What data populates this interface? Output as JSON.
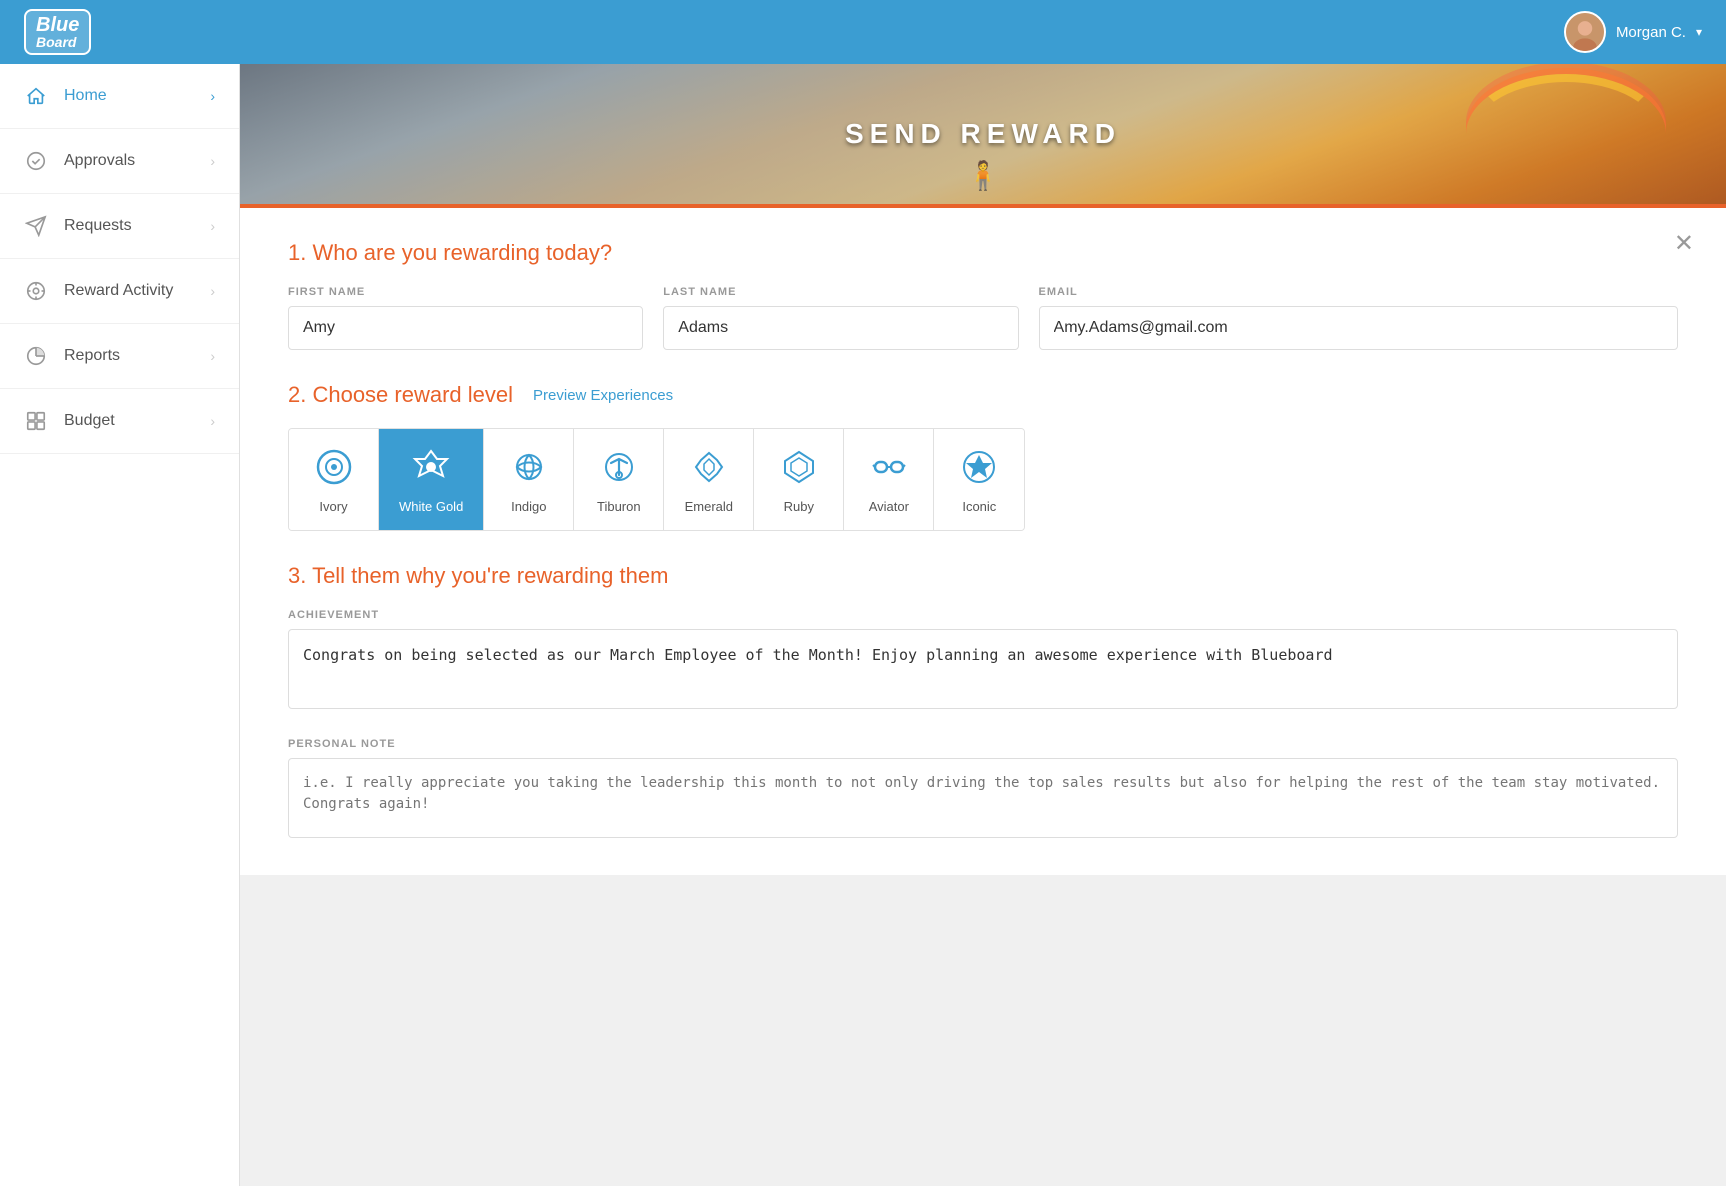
{
  "header": {
    "logo": "BlueBoard",
    "user_name": "Morgan C.",
    "chevron": "▾"
  },
  "sidebar": {
    "items": [
      {
        "id": "home",
        "label": "Home",
        "active": true
      },
      {
        "id": "approvals",
        "label": "Approvals",
        "active": false
      },
      {
        "id": "requests",
        "label": "Requests",
        "active": false
      },
      {
        "id": "reward-activity",
        "label": "Reward Activity",
        "active": false
      },
      {
        "id": "reports",
        "label": "Reports",
        "active": false
      },
      {
        "id": "budget",
        "label": "Budget",
        "active": false
      }
    ]
  },
  "hero": {
    "title": "SEND REWARD"
  },
  "form": {
    "section1_title": "1. Who are you rewarding today?",
    "first_name_label": "FIRST NAME",
    "first_name_value": "Amy",
    "last_name_label": "LAST NAME",
    "last_name_value": "Adams",
    "email_label": "EMAIL",
    "email_value": "Amy.Adams@gmail.com",
    "section2_title": "2. Choose reward level",
    "preview_link": "Preview Experiences",
    "reward_levels": [
      {
        "id": "ivory",
        "name": "Ivory",
        "active": false
      },
      {
        "id": "white-gold",
        "name": "White Gold",
        "active": true
      },
      {
        "id": "indigo",
        "name": "Indigo",
        "active": false
      },
      {
        "id": "tiburon",
        "name": "Tiburon",
        "active": false
      },
      {
        "id": "emerald",
        "name": "Emerald",
        "active": false
      },
      {
        "id": "ruby",
        "name": "Ruby",
        "active": false
      },
      {
        "id": "aviator",
        "name": "Aviator",
        "active": false
      },
      {
        "id": "iconic",
        "name": "Iconic",
        "active": false
      }
    ],
    "section3_title": "3. Tell them why you're rewarding them",
    "achievement_label": "ACHIEVEMENT",
    "achievement_value": "Congrats on being selected as our March Employee of the Month! Enjoy planning an awesome experience with Blueboard",
    "personal_note_label": "PERSONAL NOTE",
    "personal_note_placeholder": "i.e. I really appreciate you taking the leadership this month to not only driving the top sales results but also for helping the rest of the team stay motivated. Congrats again!"
  }
}
